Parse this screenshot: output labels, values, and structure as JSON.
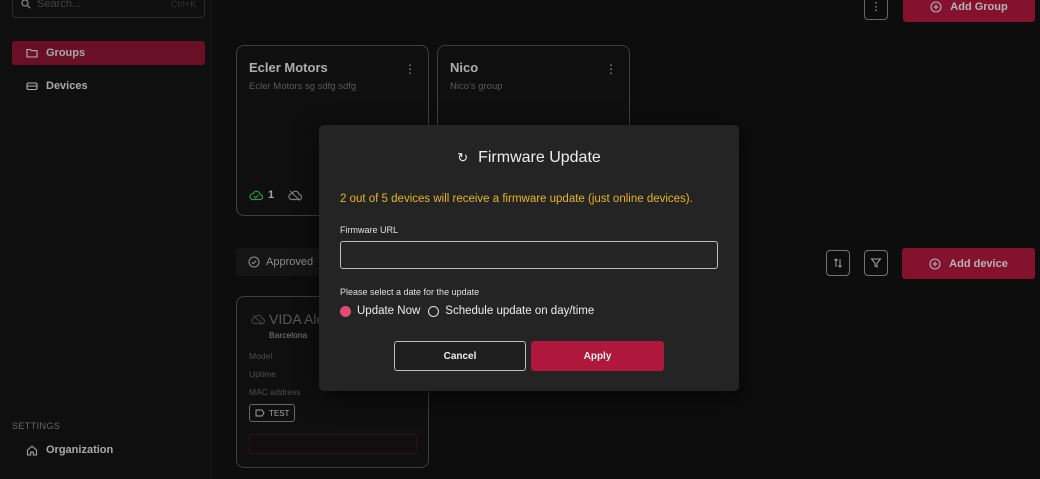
{
  "sidebar": {
    "search_placeholder": "Search...",
    "search_shortcut": "Ctrl+K",
    "items": [
      {
        "label": "Groups",
        "icon": "folder-icon"
      },
      {
        "label": "Devices",
        "icon": "device-icon"
      }
    ],
    "settings_label": "SETTINGS",
    "settings_items": [
      {
        "label": "Organization",
        "icon": "home-icon"
      }
    ]
  },
  "header": {
    "add_group_label": "Add Group"
  },
  "groups": [
    {
      "title": "Ecler Motors",
      "subtitle": "Ecler Motors sg sdfg sdfg",
      "online_count": "1"
    },
    {
      "title": "Nico",
      "subtitle": "Nico's group"
    }
  ],
  "devices_toolbar": {
    "filter_label": "Approved",
    "add_device_label": "Add device"
  },
  "device_card": {
    "name": "VIDA Ale",
    "location": "Barcelona",
    "rows": [
      "Model",
      "Uptime",
      "MAC address"
    ],
    "tag": "TEST"
  },
  "modal": {
    "title": "Firmware Update",
    "warning": "2 out of 5 devices will receive a firmware update (just online devices).",
    "url_label": "Firmware URL",
    "url_value": "",
    "date_label": "Please select a date for the update",
    "option_now": "Update Now",
    "option_schedule": "Schedule update on day/time",
    "selected_option": "Update Now",
    "cancel_label": "Cancel",
    "apply_label": "Apply"
  },
  "colors": {
    "accent": "#b0173c",
    "warning": "#e6b422",
    "radio_selected": "#e04b74"
  }
}
